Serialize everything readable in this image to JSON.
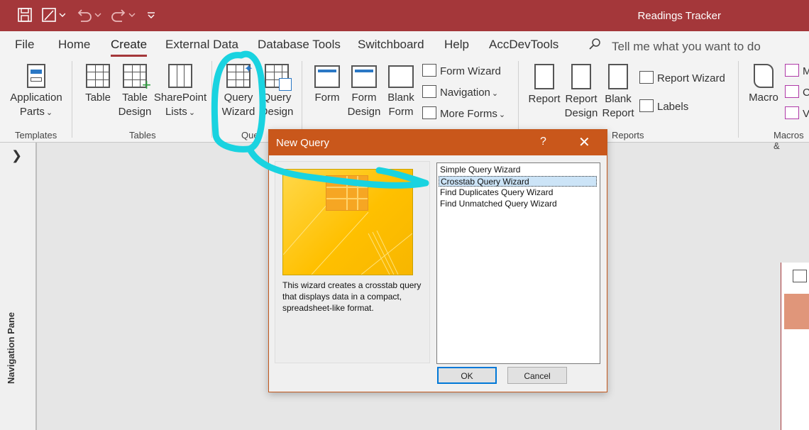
{
  "window": {
    "title": "Readings Tracker"
  },
  "tabs": [
    {
      "label": "File"
    },
    {
      "label": "Home"
    },
    {
      "label": "Create"
    },
    {
      "label": "External Data"
    },
    {
      "label": "Database Tools"
    },
    {
      "label": "Switchboard"
    },
    {
      "label": "Help"
    },
    {
      "label": "AccDevTools"
    }
  ],
  "active_tab": "Create",
  "search": {
    "placeholder": "Tell me what you want to do"
  },
  "ribbon": {
    "templates": {
      "group": "Templates",
      "application_parts_1": "Application",
      "application_parts_2": "Parts"
    },
    "tables": {
      "group": "Tables",
      "table": "Table",
      "table_design_1": "Table",
      "table_design_2": "Design",
      "sharepoint_1": "SharePoint",
      "sharepoint_2": "Lists"
    },
    "queries": {
      "group": "Queries",
      "group_visible": "Quer",
      "query_wizard_1": "Query",
      "query_wizard_2": "Wizard",
      "query_design_1": "Query",
      "query_design_2": "Design"
    },
    "forms": {
      "form": "Form",
      "form_design_1": "Form",
      "form_design_2": "Design",
      "blank_form_1": "Blank",
      "blank_form_2": "Form",
      "form_wizard": "Form Wizard",
      "navigation": "Navigation",
      "more_forms": "More Forms"
    },
    "reports": {
      "group": "Reports",
      "report": "Report",
      "report_design_1": "Report",
      "report_design_2": "Design",
      "blank_report_1": "Blank",
      "blank_report_2": "Report",
      "report_wizard": "Report Wizard",
      "labels": "Labels"
    },
    "macros": {
      "group": "Macros &",
      "macro": "Macro",
      "m_item": "M",
      "c_item": "C",
      "v_item": "V"
    }
  },
  "nav_pane": {
    "label": "Navigation Pane"
  },
  "dialog": {
    "title": "New Query",
    "help": "?",
    "description": "This wizard creates a crosstab query that displays data in a compact, spreadsheet-like format.",
    "options": [
      {
        "label": "Simple Query Wizard"
      },
      {
        "label": "Crosstab Query Wizard"
      },
      {
        "label": "Find Duplicates Query Wizard"
      },
      {
        "label": "Find Unmatched Query Wizard"
      }
    ],
    "selected_index": 1,
    "ok": "OK",
    "cancel": "Cancel"
  },
  "colors": {
    "title_bar": "#a4373a",
    "dialog_title": "#c9571b",
    "annotation": "#19d3e0"
  }
}
